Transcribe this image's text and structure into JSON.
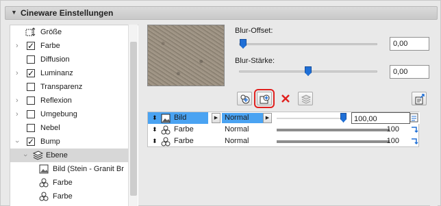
{
  "panel": {
    "title": "Cineware Einstellungen",
    "collapse_icon": "triangle-down-icon"
  },
  "tree": {
    "items": [
      {
        "label": "Größe",
        "icon": "resize-icon",
        "has_checkbox": false,
        "checked": false,
        "expandable": false
      },
      {
        "label": "Farbe",
        "icon": "",
        "has_checkbox": true,
        "checked": true,
        "expandable": true
      },
      {
        "label": "Diffusion",
        "icon": "",
        "has_checkbox": true,
        "checked": false,
        "expandable": false
      },
      {
        "label": "Luminanz",
        "icon": "",
        "has_checkbox": true,
        "checked": true,
        "expandable": true
      },
      {
        "label": "Transparenz",
        "icon": "",
        "has_checkbox": true,
        "checked": false,
        "expandable": false
      },
      {
        "label": "Reflexion",
        "icon": "",
        "has_checkbox": true,
        "checked": false,
        "expandable": true
      },
      {
        "label": "Umgebung",
        "icon": "",
        "has_checkbox": true,
        "checked": false,
        "expandable": true
      },
      {
        "label": "Nebel",
        "icon": "",
        "has_checkbox": true,
        "checked": false,
        "expandable": false
      },
      {
        "label": "Bump",
        "icon": "",
        "has_checkbox": true,
        "checked": true,
        "expandable": true
      },
      {
        "label": "Ebene",
        "icon": "layers-icon",
        "has_checkbox": false,
        "checked": false,
        "expandable": true,
        "selected": true
      },
      {
        "label": "Bild (Stein - Granit Br",
        "icon": "image-icon",
        "has_checkbox": false
      },
      {
        "label": "Farbe",
        "icon": "color-circles-icon",
        "has_checkbox": false
      },
      {
        "label": "Farbe",
        "icon": "color-circles-icon",
        "has_checkbox": false
      }
    ]
  },
  "blur_offset": {
    "label": "Blur-Offset:",
    "value": "0,00",
    "level": 0.0
  },
  "blur_staerke": {
    "label": "Blur-Stärke:",
    "value": "0,00",
    "level": 0.5
  },
  "toolbar": {
    "buttons": [
      "add-layer-icon",
      "add-image-layer-icon",
      "delete-icon",
      "stack-icon"
    ],
    "export_icon": "export-icon"
  },
  "layers": [
    {
      "name": "Bild",
      "icon": "image-icon",
      "mode": "Normal",
      "value": "100,00",
      "selected": true
    },
    {
      "name": "Farbe",
      "icon": "color-circles-icon",
      "mode": "Normal",
      "value": "100",
      "selected": false
    },
    {
      "name": "Farbe",
      "icon": "color-circles-icon",
      "mode": "Normal",
      "value": "100",
      "selected": false
    }
  ],
  "colors": {
    "accent": "#1f6fd6",
    "selection": "#4aa3f2",
    "highlight": "#e0201e"
  }
}
